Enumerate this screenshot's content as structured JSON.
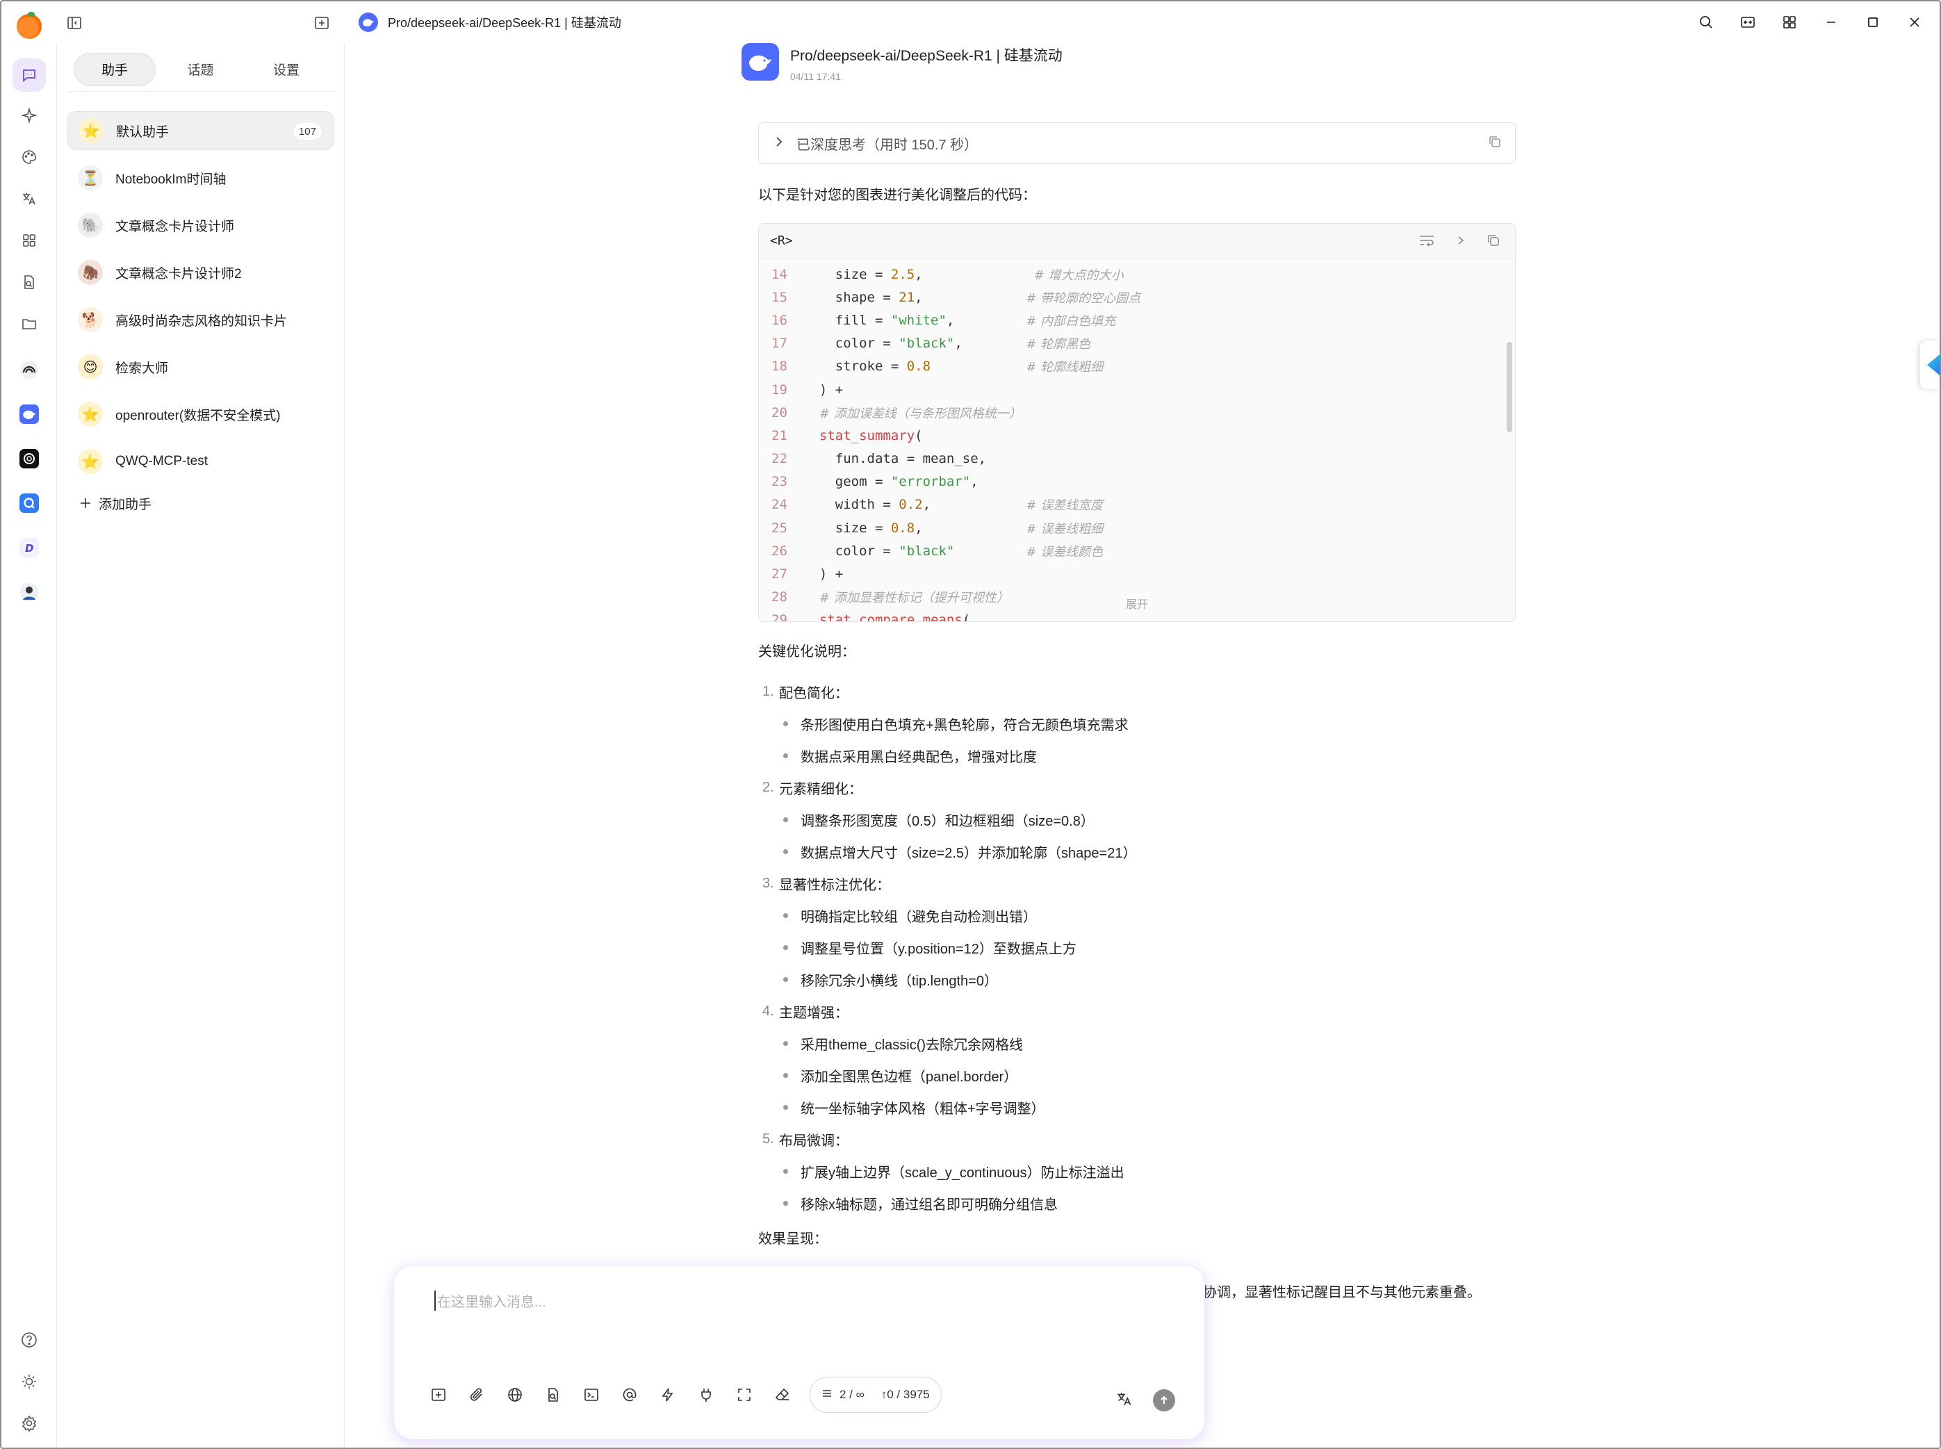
{
  "window": {
    "title": "Pro/deepseek-ai/DeepSeek-R1 | 硅基流动"
  },
  "sidebar": {
    "tabs": [
      {
        "label": "助手"
      },
      {
        "label": "话题"
      },
      {
        "label": "设置"
      }
    ],
    "assistants": [
      {
        "name": "默认助手",
        "count": "107",
        "avatar": "⭐",
        "bg": "#fff3cc"
      },
      {
        "name": "NotebookIm时间轴",
        "avatar": "⏳",
        "bg": "#f2f2f2"
      },
      {
        "name": "文章概念卡片设计师",
        "avatar": "🐘",
        "bg": "#eeeeee"
      },
      {
        "name": "文章概念卡片设计师2",
        "avatar": "🦣",
        "bg": "#f3e3dc"
      },
      {
        "name": "高级时尚杂志风格的知识卡片",
        "avatar": "🐕",
        "bg": "#fdf0e0"
      },
      {
        "name": "检索大师",
        "avatar": "😊",
        "bg": "#fff0cc"
      },
      {
        "name": "openrouter(数据不安全模式)",
        "avatar": "⭐",
        "bg": "#fff3cc"
      },
      {
        "name": "QWQ-MCP-test",
        "avatar": "⭐",
        "bg": "#fff3cc"
      }
    ],
    "add_label": "添加助手"
  },
  "message": {
    "model": "Pro/deepseek-ai/DeepSeek-R1 | 硅基流动",
    "time": "04/11 17:41",
    "thinking": "已深度思考（用时 150.7 秒）",
    "intro": "以下是针对您的图表进行美化调整后的代码：",
    "code_lang": "<R>",
    "expand_label": "展开",
    "code_lines": [
      {
        "n": "14",
        "segs": [
          {
            "t": "    size = ",
            "c": "ct"
          },
          {
            "t": "2.5",
            "c": "num"
          },
          {
            "t": ",              ",
            "c": "ct"
          },
          {
            "t": "# 增大点的大小",
            "c": "cm"
          }
        ]
      },
      {
        "n": "15",
        "segs": [
          {
            "t": "    shape = ",
            "c": "ct"
          },
          {
            "t": "21",
            "c": "num"
          },
          {
            "t": ",             ",
            "c": "ct"
          },
          {
            "t": "# 带轮廓的空心圆点",
            "c": "cm"
          }
        ]
      },
      {
        "n": "16",
        "segs": [
          {
            "t": "    fill = ",
            "c": "ct"
          },
          {
            "t": "\"white\"",
            "c": "str"
          },
          {
            "t": ",         ",
            "c": "ct"
          },
          {
            "t": "# 内部白色填充",
            "c": "cm"
          }
        ]
      },
      {
        "n": "17",
        "segs": [
          {
            "t": "    color = ",
            "c": "ct"
          },
          {
            "t": "\"black\"",
            "c": "str"
          },
          {
            "t": ",        ",
            "c": "ct"
          },
          {
            "t": "# 轮廓黑色",
            "c": "cm"
          }
        ]
      },
      {
        "n": "18",
        "segs": [
          {
            "t": "    stroke = ",
            "c": "ct"
          },
          {
            "t": "0.8",
            "c": "num"
          },
          {
            "t": "            ",
            "c": "ct"
          },
          {
            "t": "# 轮廓线粗细",
            "c": "cm"
          }
        ]
      },
      {
        "n": "19",
        "segs": [
          {
            "t": "  ) +",
            "c": "ct"
          }
        ]
      },
      {
        "n": "20",
        "segs": [
          {
            "t": "  ",
            "c": "ct"
          },
          {
            "t": "# 添加误差线（与条形图风格统一）",
            "c": "cm"
          }
        ]
      },
      {
        "n": "21",
        "segs": [
          {
            "t": "  ",
            "c": "ct"
          },
          {
            "t": "stat_summary",
            "c": "fn"
          },
          {
            "t": "(",
            "c": "ct"
          }
        ]
      },
      {
        "n": "22",
        "segs": [
          {
            "t": "    fun.data = mean_se,",
            "c": "ct"
          }
        ]
      },
      {
        "n": "23",
        "segs": [
          {
            "t": "    geom = ",
            "c": "ct"
          },
          {
            "t": "\"errorbar\"",
            "c": "str"
          },
          {
            "t": ",",
            "c": "ct"
          }
        ]
      },
      {
        "n": "24",
        "segs": [
          {
            "t": "    width = ",
            "c": "ct"
          },
          {
            "t": "0.2",
            "c": "num"
          },
          {
            "t": ",            ",
            "c": "ct"
          },
          {
            "t": "# 误差线宽度",
            "c": "cm"
          }
        ]
      },
      {
        "n": "25",
        "segs": [
          {
            "t": "    size = ",
            "c": "ct"
          },
          {
            "t": "0.8",
            "c": "num"
          },
          {
            "t": ",             ",
            "c": "ct"
          },
          {
            "t": "# 误差线粗细",
            "c": "cm"
          }
        ]
      },
      {
        "n": "26",
        "segs": [
          {
            "t": "    color = ",
            "c": "ct"
          },
          {
            "t": "\"black\"",
            "c": "str"
          },
          {
            "t": "         ",
            "c": "ct"
          },
          {
            "t": "# 误差线颜色",
            "c": "cm"
          }
        ]
      },
      {
        "n": "27",
        "segs": [
          {
            "t": "  ) +",
            "c": "ct"
          }
        ]
      },
      {
        "n": "28",
        "segs": [
          {
            "t": "  ",
            "c": "ct"
          },
          {
            "t": "# 添加显著性标记（提升可视性）",
            "c": "cm"
          }
        ]
      },
      {
        "n": "29",
        "segs": [
          {
            "t": "  ",
            "c": "ct"
          },
          {
            "t": "stat_compare_means",
            "c": "fn"
          },
          {
            "t": "(",
            "c": "ct"
          }
        ]
      }
    ],
    "key_title": "关键优化说明：",
    "sections": [
      {
        "num": "1.",
        "title": "配色简化：",
        "items": [
          "条形图使用白色填充+黑色轮廓，符合无颜色填充需求",
          "数据点采用黑白经典配色，增强对比度"
        ]
      },
      {
        "num": "2.",
        "title": "元素精细化：",
        "items": [
          "调整条形图宽度（0.5）和边框粗细（size=0.8）",
          "数据点增大尺寸（size=2.5）并添加轮廓（shape=21）"
        ]
      },
      {
        "num": "3.",
        "title": "显著性标注优化：",
        "items": [
          "明确指定比较组（避免自动检测出错）",
          "调整星号位置（y.position=12）至数据点上方",
          "移除冗余小横线（tip.length=0）"
        ]
      },
      {
        "num": "4.",
        "title": "主题增强：",
        "items": [
          "采用theme_classic()去除冗余网格线",
          "添加全图黑色边框（panel.border）",
          "统一坐标轴字体风格（粗体+字号调整）"
        ]
      },
      {
        "num": "5.",
        "title": "布局微调：",
        "items": [
          "扩展y轴上边界（scale_y_continuous）防止标注溢出",
          "移除x轴标题，通过组名即可明确分组信息"
        ]
      }
    ],
    "effect_title": "效果呈现：",
    "summary": "生成的图表将具有学术期刊级的简洁风格，黑白对比清晰，所有元素比例协调，显著性标记醒目且不与其他元素重叠。"
  },
  "input": {
    "placeholder": "在这里输入消息...",
    "context_count": "2 / ∞",
    "token_count": "↑0 / 3975"
  },
  "colors": {
    "accent": "#6b46e5",
    "deepseek": "#4d6bfe"
  }
}
